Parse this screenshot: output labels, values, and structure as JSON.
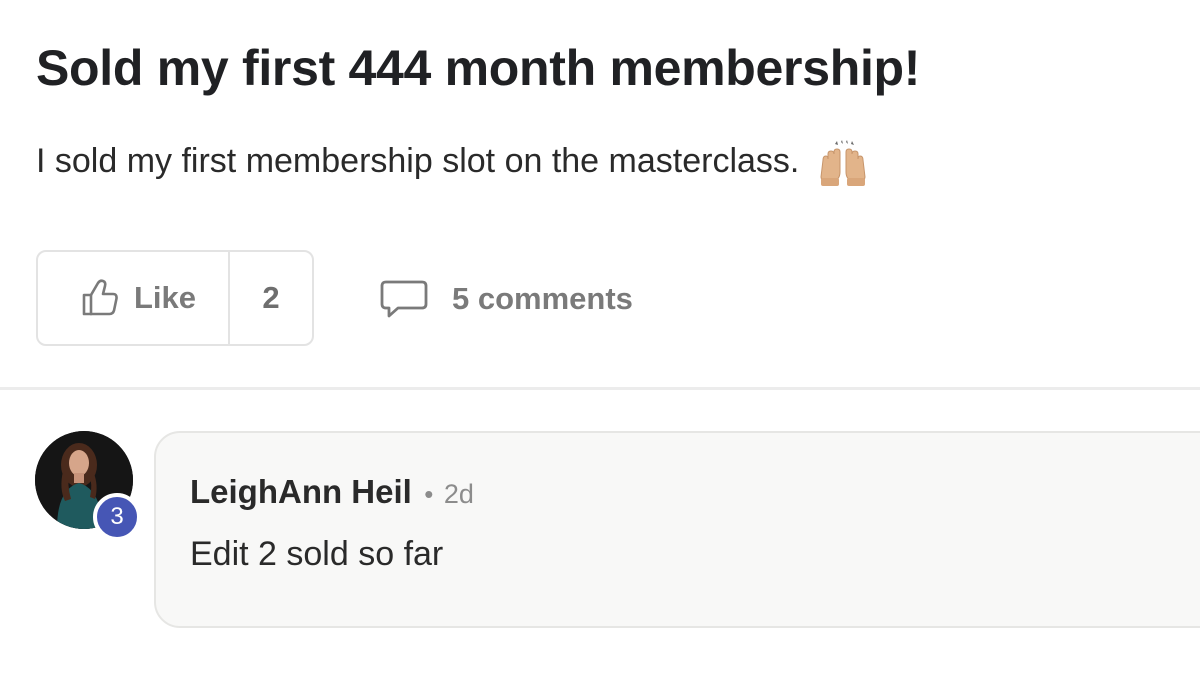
{
  "post": {
    "title": "Sold my first 444 month membership!",
    "body": "I sold my first membership slot on the masterclass.",
    "emoji": "raising-hands-emoji"
  },
  "actions": {
    "like_label": "Like",
    "like_count": "2",
    "comments_label": "5 comments",
    "like_icon": "thumbs-up-icon",
    "comments_icon": "speech-bubble-icon"
  },
  "comment": {
    "author": "LeighAnn Heil",
    "separator": "•",
    "time": "2d",
    "text": "Edit 2 sold so far",
    "level": "3",
    "level_color": "#4656b5"
  }
}
